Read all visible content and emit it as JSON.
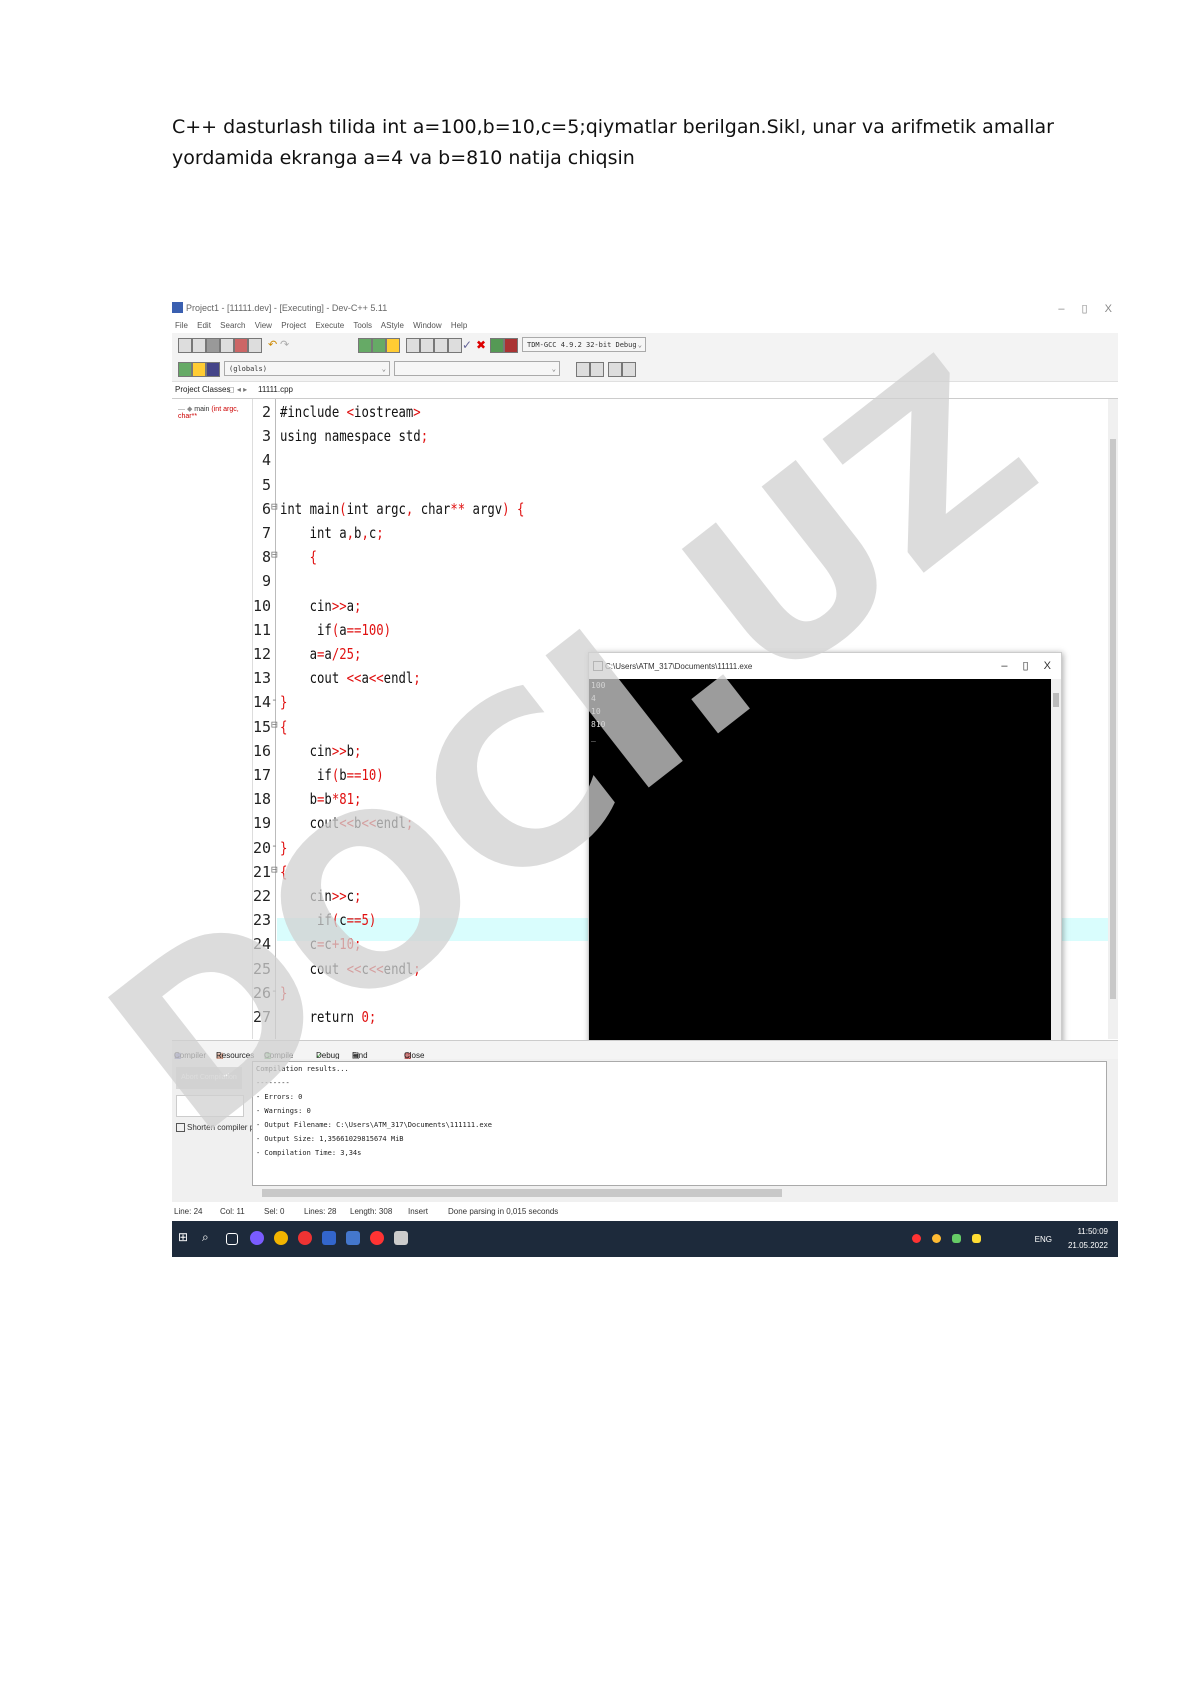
{
  "task_text": "C++ dasturlash tilida int a=100,b=10,c=5;qiymatlar berilgan.Sikl, unar va arifmetik amallar yordamida ekranga a=4 va b=810 natija chiqsin",
  "ide": {
    "window_title": "Project1 - [11111.dev] - [Executing] - Dev-C++ 5.11",
    "window_controls": {
      "minimize": "–",
      "maximize": "▯",
      "close": "X"
    },
    "menu": [
      "File",
      "Edit",
      "Search",
      "View",
      "Project",
      "Execute",
      "Tools",
      "AStyle",
      "Window",
      "Help"
    ],
    "compiler_select": "TDM-GCC 4.9.2 32-bit Debug",
    "scope_select": "(globals)",
    "left_tabs": [
      "Project",
      "Classes"
    ],
    "file_tab": "11111.cpp",
    "class_tree_item": {
      "name": "main",
      "signature": "(int argc, char**"
    },
    "code_lines": [
      {
        "n": "2",
        "fold": "",
        "text": "#include <iostream>"
      },
      {
        "n": "3",
        "fold": "",
        "text": "using namespace std;"
      },
      {
        "n": "4",
        "fold": "",
        "text": ""
      },
      {
        "n": "5",
        "fold": "",
        "text": ""
      },
      {
        "n": "6",
        "fold": "⊟",
        "text": "int main(int argc, char** argv) {"
      },
      {
        "n": "7",
        "fold": "",
        "text": "    int a,b,c;"
      },
      {
        "n": "8",
        "fold": "⊟",
        "text": "    {"
      },
      {
        "n": "9",
        "fold": "",
        "text": ""
      },
      {
        "n": "10",
        "fold": "",
        "text": "    cin>>a;"
      },
      {
        "n": "11",
        "fold": "",
        "text": "     if(a==100)"
      },
      {
        "n": "12",
        "fold": "",
        "text": "    a=a/25;"
      },
      {
        "n": "13",
        "fold": "",
        "text": "    cout <<a<<endl;"
      },
      {
        "n": "14",
        "fold": "-",
        "text": "}"
      },
      {
        "n": "15",
        "fold": "⊟",
        "text": "{"
      },
      {
        "n": "16",
        "fold": "",
        "text": "    cin>>b;"
      },
      {
        "n": "17",
        "fold": "",
        "text": "     if(b==10)"
      },
      {
        "n": "18",
        "fold": "",
        "text": "    b=b*81;"
      },
      {
        "n": "19",
        "fold": "",
        "text": "    cout<<b<<endl;"
      },
      {
        "n": "20",
        "fold": "-",
        "text": "}"
      },
      {
        "n": "21",
        "fold": "⊟",
        "text": "{"
      },
      {
        "n": "22",
        "fold": "",
        "text": "    cin>>c;"
      },
      {
        "n": "23",
        "fold": "",
        "text": "     if(c==5)"
      },
      {
        "n": "24",
        "fold": "",
        "text": "    c=c+10;"
      },
      {
        "n": "25",
        "fold": "",
        "text": "    cout <<c<<endl;"
      },
      {
        "n": "26",
        "fold": "-",
        "text": "}"
      },
      {
        "n": "27",
        "fold": "",
        "text": "    return 0;"
      }
    ],
    "console": {
      "title": "C:\\Users\\ATM_317\\Documents\\11111.exe",
      "output": [
        "100",
        "4",
        "10",
        "810",
        "_"
      ]
    },
    "bottom_tabs": [
      "Compiler",
      "Resources",
      "Compile Log",
      "Debug",
      "Find Results",
      "Close"
    ],
    "abort_label": "Abort Compilation",
    "shorten_label": "Shorten compiler paths",
    "compile_log": [
      "Compilation results...",
      "--------",
      "- Errors: 0",
      "- Warnings: 0",
      "- Output Filename: C:\\Users\\ATM_317\\Documents\\111111.exe",
      "- Output Size: 1,35661029815674 MiB",
      "- Compilation Time: 3,34s"
    ],
    "status": {
      "line": "Line:  24",
      "col": "Col:  11",
      "sel": "Sel:  0",
      "lines": "Lines:  28",
      "length": "Length:  308",
      "mode": "Insert",
      "message": "Done parsing in 0,015 seconds"
    },
    "taskbar": {
      "lang": "ENG",
      "time": "11:50:09",
      "date": "21.05.2022"
    }
  },
  "watermark": "DOCI.UZ",
  "colors": {
    "keyword_red": "#e01010",
    "highlight_line": "#d9fdfd",
    "taskbar": "#1d2a3b",
    "watermark": "#d5d5d5"
  }
}
